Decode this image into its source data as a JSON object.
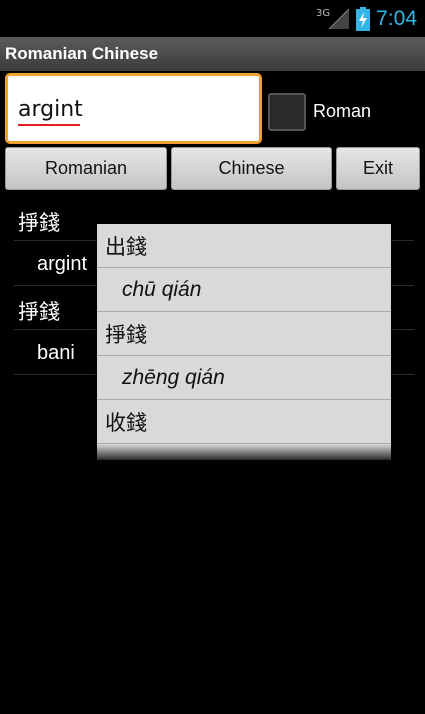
{
  "status_bar": {
    "network": "3G",
    "time": "7:04"
  },
  "app": {
    "title": "Romanian Chinese"
  },
  "search": {
    "value": "argint"
  },
  "roman_toggle": {
    "label": "Roman",
    "checked": false
  },
  "buttons": {
    "romanian": "Romanian",
    "chinese": "Chinese",
    "exit": "Exit"
  },
  "results": [
    {
      "chinese": "掙錢",
      "romanian": "argint"
    },
    {
      "chinese": "掙錢",
      "romanian": "bani"
    }
  ],
  "suggestions": [
    {
      "hanzi": "出錢",
      "pinyin": "chū qián"
    },
    {
      "hanzi": "掙錢",
      "pinyin": "zhēng qián"
    },
    {
      "hanzi": "收錢",
      "pinyin": ""
    }
  ],
  "colors": {
    "accent": "#f0a030",
    "clock": "#33b5e5",
    "spellcheck": "#e02020"
  }
}
